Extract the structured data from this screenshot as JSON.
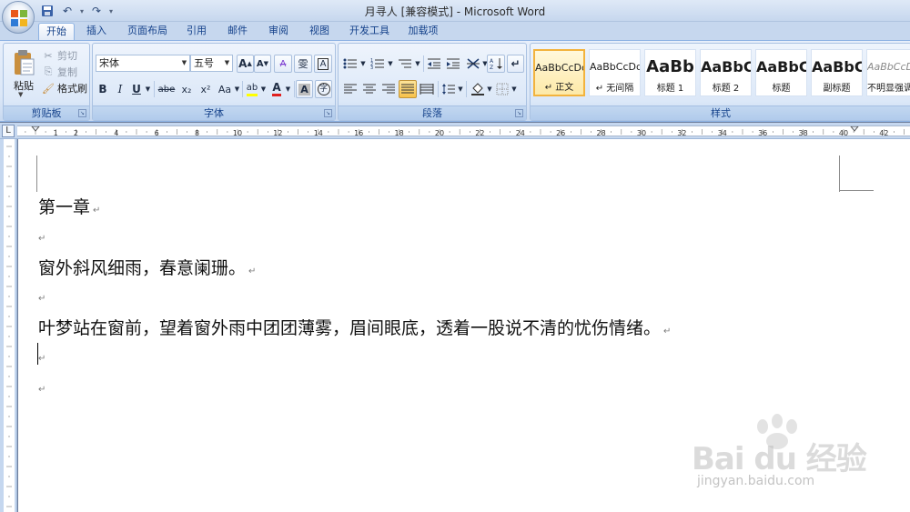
{
  "window": {
    "title": "月寻人 [兼容模式] - Microsoft Word"
  },
  "tabs": [
    "开始",
    "插入",
    "页面布局",
    "引用",
    "邮件",
    "审阅",
    "视图",
    "开发工具",
    "加载项"
  ],
  "clipboard": {
    "group": "剪贴板",
    "paste": "粘贴",
    "cut": "剪切",
    "copy": "复制",
    "format_painter": "格式刷"
  },
  "font": {
    "group": "字体",
    "name": "宋体",
    "size": "五号",
    "grow": "A",
    "shrink": "A",
    "clear": "A",
    "phonetic": "雯",
    "border_char": "A",
    "bold": "B",
    "italic": "I",
    "underline": "U",
    "strike": "abe",
    "subscript": "x₂",
    "superscript": "x²",
    "change_case": "Aa",
    "highlight": "ab",
    "font_color": "A",
    "shade": "A",
    "enclose": "字"
  },
  "paragraph": {
    "group": "段落"
  },
  "styles": {
    "group": "样式",
    "items": [
      {
        "sample": "AaBbCcDd",
        "name": "↵ 正文"
      },
      {
        "sample": "AaBbCcDd",
        "name": "↵ 无间隔"
      },
      {
        "sample": "AaBb",
        "name": "标题 1"
      },
      {
        "sample": "AaBbC",
        "name": "标题 2"
      },
      {
        "sample": "AaBbC",
        "name": "标题"
      },
      {
        "sample": "AaBbC",
        "name": "副标题"
      },
      {
        "sample": "AaBbCcDd",
        "name": "不明显强调"
      }
    ]
  },
  "ruler": {
    "numbers": [
      "1",
      "2",
      "4",
      "6",
      "8",
      "10",
      "12",
      "14",
      "16",
      "18",
      "20",
      "22",
      "24",
      "26",
      "28",
      "30",
      "32",
      "34",
      "36",
      "38",
      "40",
      "42"
    ]
  },
  "document": {
    "paragraphs": [
      "第一章",
      "",
      "窗外斜风细雨，春意阑珊。",
      "",
      "叶梦站在窗前，望着窗外雨中团团薄雾，眉间眼底，透着一股说不清的忧伤情绪。",
      "",
      ""
    ],
    "para_mark": "↵"
  },
  "watermark": {
    "text": "Bai du 经验",
    "url": "jingyan.baidu.com"
  },
  "colors": {
    "highlight": "#ffff00",
    "font_color": "#e0201f",
    "accent": "#15428b"
  }
}
